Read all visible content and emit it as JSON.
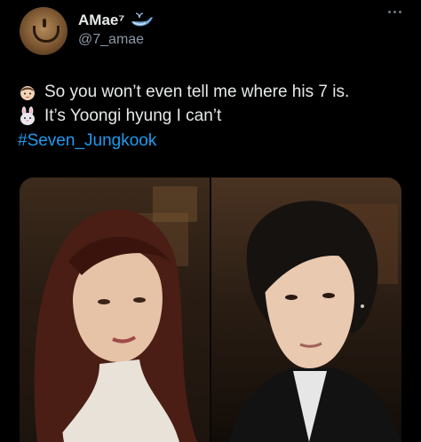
{
  "user": {
    "display_name": "AMae⁷",
    "handle": "@7_amae"
  },
  "icons": {
    "verified_badge": "whale-emoji",
    "more": "more-horizontal-icon"
  },
  "tweet": {
    "line1_emoji": "baby-emoji",
    "line1_text": "So you won’t  even tell me where his 7 is.",
    "line2_emoji": "rabbit-face-emoji",
    "line2_text": "It’s Yoongi hyung I can’t",
    "hashtag": "#Seven_Jungkook"
  },
  "colors": {
    "background": "#000000",
    "text": "#e7e9ea",
    "secondary": "#8b98a5",
    "link": "#1d9bf0"
  }
}
